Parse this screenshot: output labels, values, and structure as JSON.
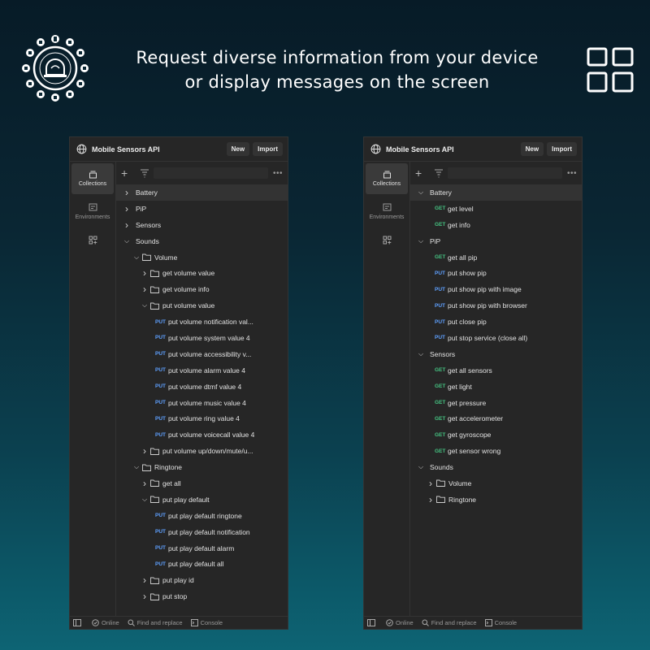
{
  "headline": [
    "Request diverse information from your device",
    "or display messages on the screen"
  ],
  "colors": {
    "put": "#5ea0ff",
    "get": "#45c281",
    "panel_bg": "#262626"
  },
  "panels": [
    {
      "title": "Mobile Sensors API",
      "new_label": "New",
      "import_label": "Import",
      "sidebar": {
        "collections": "Collections",
        "environments": "Environments"
      },
      "status": {
        "online": "Online",
        "find": "Find and replace",
        "console": "Console"
      },
      "rows": [
        {
          "d": 0,
          "c": "right",
          "t": "Battery",
          "hl": true
        },
        {
          "d": 0,
          "c": "right",
          "t": "PiP"
        },
        {
          "d": 0,
          "c": "right",
          "t": "Sensors"
        },
        {
          "d": 0,
          "c": "down",
          "t": "Sounds"
        },
        {
          "d": 1,
          "c": "down",
          "f": true,
          "t": "Volume"
        },
        {
          "d": 2,
          "c": "right",
          "f": true,
          "t": "get volume value"
        },
        {
          "d": 2,
          "c": "right",
          "f": true,
          "t": "get volume info"
        },
        {
          "d": 2,
          "c": "down",
          "f": true,
          "t": "put volume value"
        },
        {
          "d": 3,
          "m": "PUT",
          "t": "put volume notification val..."
        },
        {
          "d": 3,
          "m": "PUT",
          "t": "put volume system value 4"
        },
        {
          "d": 3,
          "m": "PUT",
          "t": "put volume accessibility v..."
        },
        {
          "d": 3,
          "m": "PUT",
          "t": "put volume alarm value 4"
        },
        {
          "d": 3,
          "m": "PUT",
          "t": "put volume dtmf value 4"
        },
        {
          "d": 3,
          "m": "PUT",
          "t": "put volume music value 4"
        },
        {
          "d": 3,
          "m": "PUT",
          "t": "put volume ring value 4"
        },
        {
          "d": 3,
          "m": "PUT",
          "t": "put volume voicecall value 4"
        },
        {
          "d": 2,
          "c": "right",
          "f": true,
          "t": "put volume up/down/mute/u..."
        },
        {
          "d": 1,
          "c": "down",
          "f": true,
          "t": "Ringtone"
        },
        {
          "d": 2,
          "c": "right",
          "f": true,
          "t": "get all"
        },
        {
          "d": 2,
          "c": "down",
          "f": true,
          "t": "put play default"
        },
        {
          "d": 3,
          "m": "PUT",
          "t": "put play default ringtone"
        },
        {
          "d": 3,
          "m": "PUT",
          "t": "put play default notification"
        },
        {
          "d": 3,
          "m": "PUT",
          "t": "put play default alarm"
        },
        {
          "d": 3,
          "m": "PUT",
          "t": "put play default all"
        },
        {
          "d": 2,
          "c": "right",
          "f": true,
          "t": "put play id"
        },
        {
          "d": 2,
          "c": "right",
          "f": true,
          "t": "put stop"
        }
      ]
    },
    {
      "title": "Mobile Sensors API",
      "new_label": "New",
      "import_label": "Import",
      "sidebar": {
        "collections": "Collections",
        "environments": "Environments"
      },
      "status": {
        "online": "Online",
        "find": "Find and replace",
        "console": "Console"
      },
      "rows": [
        {
          "d": 0,
          "c": "down",
          "t": "Battery",
          "hl": true
        },
        {
          "d": 2,
          "m": "GET",
          "t": "get level"
        },
        {
          "d": 2,
          "m": "GET",
          "t": "get info"
        },
        {
          "d": 0,
          "c": "down",
          "t": "PiP"
        },
        {
          "d": 2,
          "m": "GET",
          "t": "get all pip"
        },
        {
          "d": 2,
          "m": "PUT",
          "t": "put show pip"
        },
        {
          "d": 2,
          "m": "PUT",
          "t": "put show pip with image"
        },
        {
          "d": 2,
          "m": "PUT",
          "t": "put show pip with browser"
        },
        {
          "d": 2,
          "m": "PUT",
          "t": "put close pip"
        },
        {
          "d": 2,
          "m": "PUT",
          "t": "put stop service (close all)"
        },
        {
          "d": 0,
          "c": "down",
          "t": "Sensors"
        },
        {
          "d": 2,
          "m": "GET",
          "t": "get all sensors"
        },
        {
          "d": 2,
          "m": "GET",
          "t": "get light"
        },
        {
          "d": 2,
          "m": "GET",
          "t": "get pressure"
        },
        {
          "d": 2,
          "m": "GET",
          "t": "get accelerometer"
        },
        {
          "d": 2,
          "m": "GET",
          "t": "get gyroscope"
        },
        {
          "d": 2,
          "m": "GET",
          "t": "get sensor wrong"
        },
        {
          "d": 0,
          "c": "down",
          "t": "Sounds"
        },
        {
          "d": 1,
          "c": "right",
          "f": true,
          "t": "Volume"
        },
        {
          "d": 1,
          "c": "right",
          "f": true,
          "t": "Ringtone"
        }
      ]
    }
  ]
}
